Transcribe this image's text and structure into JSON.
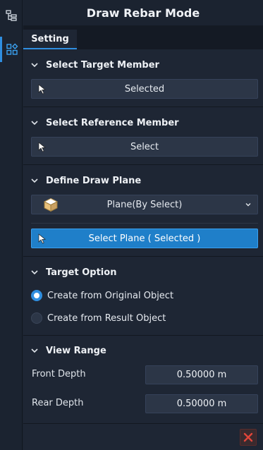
{
  "rail": {
    "items": [
      {
        "icon": "tree-hierarchy-icon",
        "active": false
      },
      {
        "icon": "panel-shapes-icon",
        "active": true
      }
    ]
  },
  "panel": {
    "title": "Draw Rebar Mode",
    "tab": "Setting"
  },
  "sections": {
    "target_member": {
      "header": "Select Target Member",
      "button": "Selected"
    },
    "reference_member": {
      "header": "Select Reference Member",
      "button": "Select"
    },
    "draw_plane": {
      "header": "Define Draw Plane",
      "plane_select": "Plane(By Select)",
      "select_plane_button": "Select Plane ( Selected )"
    },
    "target_option": {
      "header": "Target Option",
      "options": [
        {
          "label": "Create from Original Object",
          "selected": true
        },
        {
          "label": "Create from Result Object",
          "selected": false
        }
      ]
    },
    "view_range": {
      "header": "View Range",
      "front_depth_label": "Front Depth",
      "front_depth_value": "0.50000 m",
      "rear_depth_label": "Rear Depth",
      "rear_depth_value": "0.50000 m"
    }
  },
  "colors": {
    "accent": "#2f8ee0",
    "primary_button": "#1f7fc9",
    "close": "#e0453a"
  }
}
